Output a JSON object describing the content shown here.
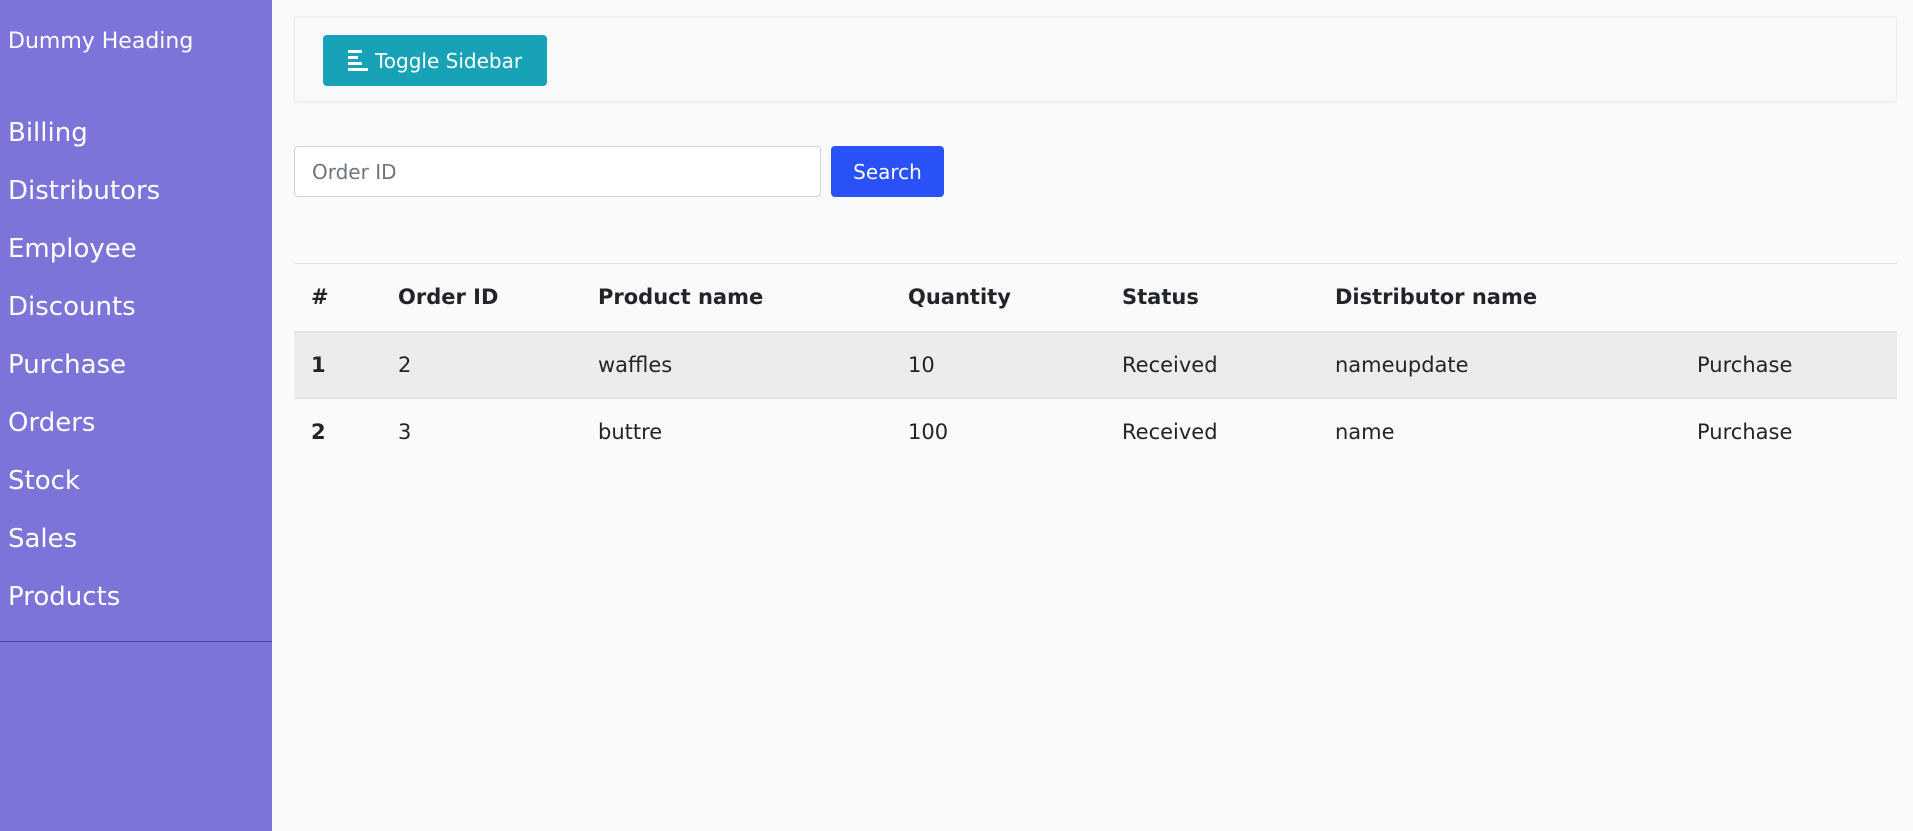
{
  "sidebar": {
    "heading": "Dummy Heading",
    "items": [
      {
        "label": "Billing"
      },
      {
        "label": "Distributors"
      },
      {
        "label": "Employee"
      },
      {
        "label": "Discounts"
      },
      {
        "label": "Purchase"
      },
      {
        "label": "Orders"
      },
      {
        "label": "Stock"
      },
      {
        "label": "Sales"
      },
      {
        "label": "Products"
      }
    ]
  },
  "topbar": {
    "toggle_label": "Toggle Sidebar",
    "toggle_icon": "align-left-icon"
  },
  "search": {
    "placeholder": "Order ID",
    "value": "",
    "button_label": "Search"
  },
  "table": {
    "headers": [
      "#",
      "Order ID",
      "Product name",
      "Quantity",
      "Status",
      "Distributor name",
      ""
    ],
    "rows": [
      {
        "num": "1",
        "order_id": "2",
        "product": "waffles",
        "quantity": "10",
        "status": "Received",
        "distributor": "nameupdate",
        "action": "Purchase"
      },
      {
        "num": "2",
        "order_id": "3",
        "product": "buttre",
        "quantity": "100",
        "status": "Received",
        "distributor": "name",
        "action": "Purchase"
      }
    ]
  },
  "colors": {
    "sidebar_bg": "#7c74d9",
    "toggle_btn": "#17a2b8",
    "search_btn": "#2a51f7",
    "stripe": "#ececec"
  }
}
